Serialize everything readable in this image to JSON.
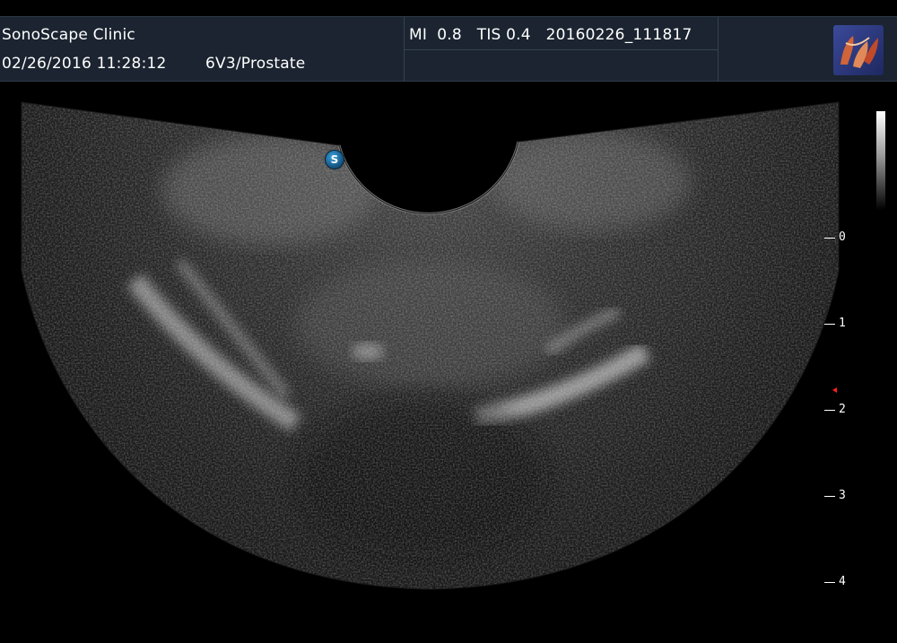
{
  "header": {
    "clinic_name": "SonoScape Clinic",
    "datetime": "02/26/2016 11:28:12",
    "probe_preset": "6V3/Prostate",
    "power_readout": "MI  0.8   TIS 0.4   20160226_111817"
  },
  "image": {
    "orientation_marker": "S",
    "depth_scale": {
      "unit": "",
      "labels": [
        "0",
        "1",
        "2",
        "3",
        "4"
      ]
    },
    "focus_marker_color": "#ff2020"
  },
  "colors": {
    "header_bg": "#1b2430",
    "text": "#ffffff",
    "marker_blue": "#2a84c0"
  },
  "icons": {
    "brand_logo": "sonoscape-logo-icon",
    "orientation": "orientation-s-icon"
  }
}
